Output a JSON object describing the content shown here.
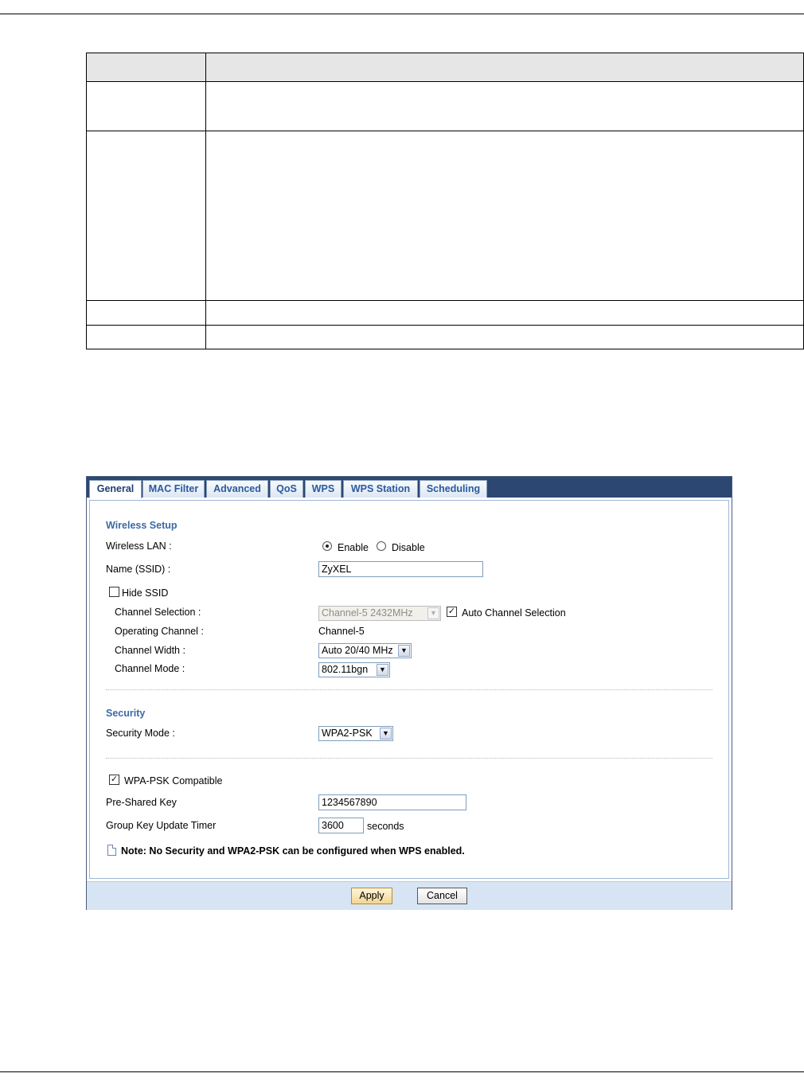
{
  "tabs": [
    {
      "label": "General",
      "active": true
    },
    {
      "label": "MAC Filter",
      "active": false
    },
    {
      "label": "Advanced",
      "active": false
    },
    {
      "label": "QoS",
      "active": false
    },
    {
      "label": "WPS",
      "active": false
    },
    {
      "label": "WPS Station",
      "active": false
    },
    {
      "label": "Scheduling",
      "active": false
    }
  ],
  "wireless_setup": {
    "section_title": "Wireless Setup",
    "wireless_lan_label": "Wireless LAN :",
    "enable_label": "Enable",
    "disable_label": "Disable",
    "wireless_lan_value": "Enable",
    "ssid_label": "Name (SSID) :",
    "ssid_value": "ZyXEL",
    "hide_ssid_label": "Hide SSID",
    "hide_ssid_checked": false,
    "channel_selection_label": "Channel Selection :",
    "channel_selection_value": "Channel-5 2432MHz",
    "auto_channel_label": "Auto Channel Selection",
    "auto_channel_checked": true,
    "operating_channel_label": "Operating Channel :",
    "operating_channel_value": "Channel-5",
    "channel_width_label": "Channel Width :",
    "channel_width_value": "Auto 20/40 MHz",
    "channel_mode_label": "Channel Mode :",
    "channel_mode_value": "802.11bgn"
  },
  "security": {
    "section_title": "Security",
    "mode_label": "Security Mode :",
    "mode_value": "WPA2-PSK",
    "wpa_psk_compatible_label": "WPA-PSK Compatible",
    "wpa_psk_compatible_checked": true,
    "psk_label": "Pre-Shared Key",
    "psk_value": "1234567890",
    "group_key_label": "Group Key Update Timer",
    "group_key_value": "3600",
    "group_key_unit": "seconds",
    "note": "Note: No Security and WPA2-PSK can be configured when WPS enabled."
  },
  "buttons": {
    "apply": "Apply",
    "cancel": "Cancel"
  },
  "icons": {
    "radio_checked": "radio-checked-icon",
    "radio_unchecked": "radio-unchecked-icon",
    "checkbox_checked": "checkbox-checked-icon",
    "checkbox_unchecked": "checkbox-unchecked-icon",
    "dropdown_arrow": "chevron-down-icon",
    "note": "note-icon"
  },
  "colors": {
    "tabbar": "#2b4772",
    "section_title": "#3a6aa6",
    "footer": "#d7e4f4"
  }
}
